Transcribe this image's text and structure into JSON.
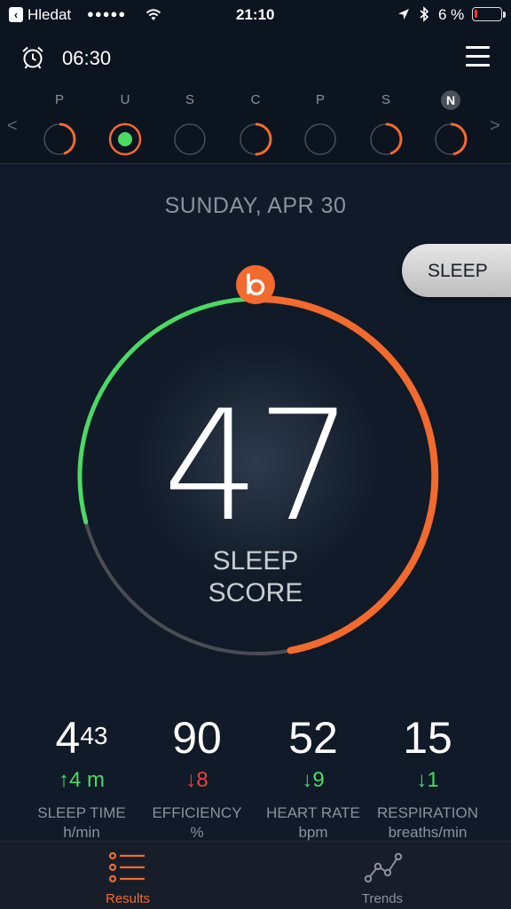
{
  "status_bar": {
    "back_label": "Hledat",
    "time": "21:10",
    "battery": "6 %",
    "signal_dots": "●●●●●"
  },
  "header": {
    "alarm_time": "06:30"
  },
  "days": [
    {
      "letter": "P",
      "progress": 0.45
    },
    {
      "letter": "U",
      "progress": 1.0,
      "selected": true
    },
    {
      "letter": "S",
      "progress": 0.0
    },
    {
      "letter": "C",
      "progress": 0.5
    },
    {
      "letter": "P",
      "progress": 0.0
    },
    {
      "letter": "S",
      "progress": 0.45
    },
    {
      "letter": "N",
      "progress": 0.47,
      "today": true
    }
  ],
  "nav": {
    "prev": "<",
    "next": ">"
  },
  "main": {
    "date": "SUNDAY, APR 30",
    "mode_button": "SLEEP",
    "score": "47",
    "score_label_1": "SLEEP",
    "score_label_2": "SCORE",
    "score_fraction": 0.47,
    "badge_icon": "beddit-logo-icon"
  },
  "metrics": [
    {
      "value": "4",
      "value_sup": "43",
      "change": "↑4 m",
      "direction": "up",
      "label": "SLEEP TIME",
      "unit": "h/min"
    },
    {
      "value": "90",
      "value_sup": "",
      "change": "↓8",
      "direction": "down-bad",
      "label": "EFFICIENCY",
      "unit": "%"
    },
    {
      "value": "52",
      "value_sup": "",
      "change": "↓9",
      "direction": "down-good",
      "label": "HEART RATE",
      "unit": "bpm"
    },
    {
      "value": "15",
      "value_sup": "",
      "change": "↓1",
      "direction": "down-good",
      "label": "RESPIRATION",
      "unit": "breaths/min"
    }
  ],
  "tabs": [
    {
      "label": "Results",
      "active": true,
      "icon": "list-icon"
    },
    {
      "label": "Trends",
      "active": false,
      "icon": "trends-icon"
    }
  ],
  "colors": {
    "accent": "#f26a2e",
    "good": "#4cd964",
    "bad": "#f0413a",
    "track": "#4a4e54",
    "muted": "#8a929c"
  }
}
